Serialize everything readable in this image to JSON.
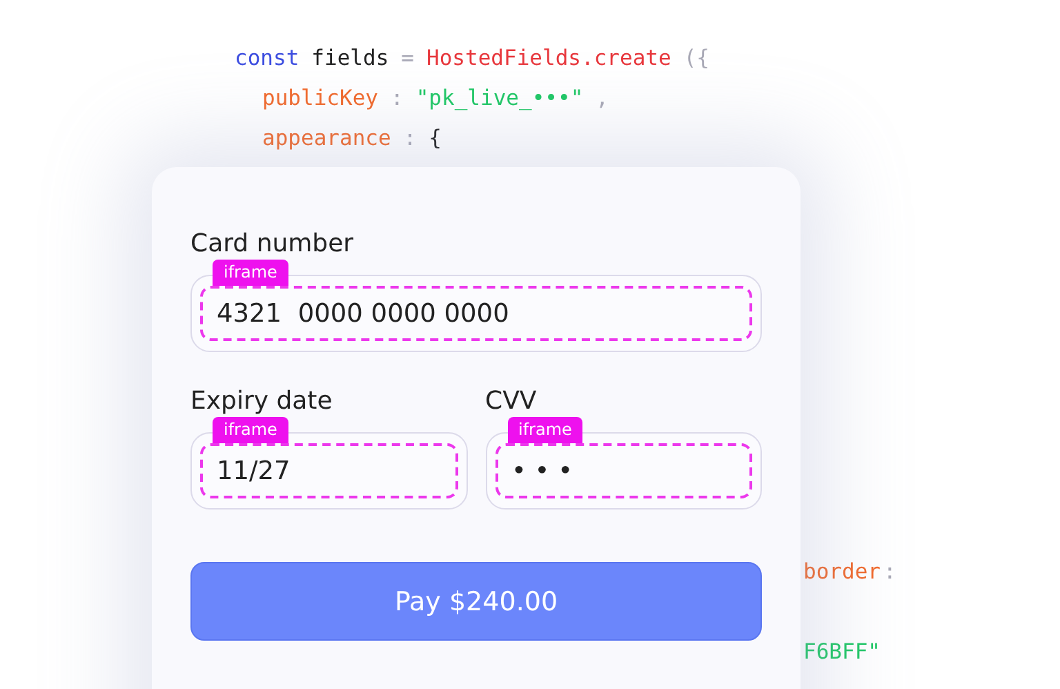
{
  "code": {
    "lines": [
      {
        "tokens": [
          {
            "kind": "keyword",
            "text": "const"
          },
          {
            "kind": "plain",
            "text": "fields"
          },
          {
            "kind": "punct",
            "text": "="
          },
          {
            "kind": "func",
            "text": "HostedFields.create"
          },
          {
            "kind": "punct",
            "text": "({"
          }
        ],
        "children": [
          {
            "tokens": [
              {
                "kind": "prop",
                "text": "publicKey"
              },
              {
                "kind": "punct",
                "text": ":"
              },
              {
                "kind": "string",
                "text": "\"pk_live_•••\""
              },
              {
                "kind": "punct",
                "text": ","
              }
            ]
          },
          {
            "tokens": [
              {
                "kind": "prop",
                "text": "appearance"
              },
              {
                "kind": "punct",
                "text": ":"
              },
              {
                "kind": "plain",
                "text": "{"
              }
            ]
          }
        ]
      }
    ],
    "fragments": [
      {
        "tokens": [
          {
            "kind": "prop",
            "text": "border"
          },
          {
            "kind": "punct",
            "text": ":"
          }
        ]
      },
      {
        "tokens": [
          {
            "kind": "string",
            "text": "F6BFF\""
          }
        ]
      }
    ]
  },
  "card": {
    "rows": [
      {
        "fields": [
          {
            "label": "Card number",
            "tag": "iframe",
            "value": "4321  0000 0000 0000"
          }
        ]
      },
      {
        "fields": [
          {
            "label": "Expiry date",
            "tag": "iframe",
            "value": "11/27"
          },
          {
            "label": "CVV",
            "tag": "iframe",
            "value": "• • •"
          }
        ]
      }
    ],
    "button": "Pay $240.00"
  }
}
